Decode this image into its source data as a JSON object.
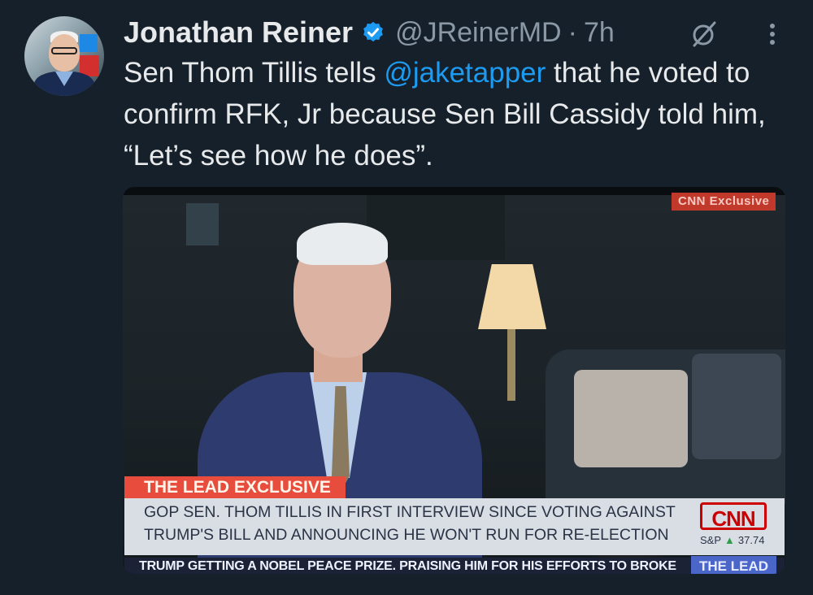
{
  "tweet": {
    "author_name": "Jonathan Reiner",
    "handle": "@JReinerMD",
    "separator": "·",
    "time": "7h",
    "text_before": "Sen Thom Tillis tells ",
    "mention": "@jaketapper",
    "text_after": " that he voted to confirm RFK, Jr because Sen Bill Cassidy told him, “Let’s  see how he does”."
  },
  "icons": {
    "verified": "verified-badge-icon",
    "grok": "grok-icon",
    "more": "more-options-icon"
  },
  "colors": {
    "background": "#15202b",
    "text": "#e7e9ea",
    "muted": "#8b98a5",
    "link": "#1d9bf0",
    "verified": "#1d9bf0",
    "cnn_red": "#cc0000"
  },
  "media": {
    "exclusive_tag": "CNN Exclusive",
    "lead_tag": "THE LEAD EXCLUSIVE",
    "lower_third_line1": "GOP SEN. THOM TILLIS IN FIRST INTERVIEW SINCE VOTING AGAINST",
    "lower_third_line2": "TRUMP'S BILL AND ANNOUNCING HE WON'T RUN FOR RE-ELECTION",
    "network_logo": "CNN",
    "market_label": "S&P",
    "market_value": "37.74",
    "crawl_text": "TRUMP GETTING A NOBEL PEACE PRIZE. PRAISING HIM FOR HIS EFFORTS TO BROKE",
    "crawl_show": "THE LEAD"
  }
}
